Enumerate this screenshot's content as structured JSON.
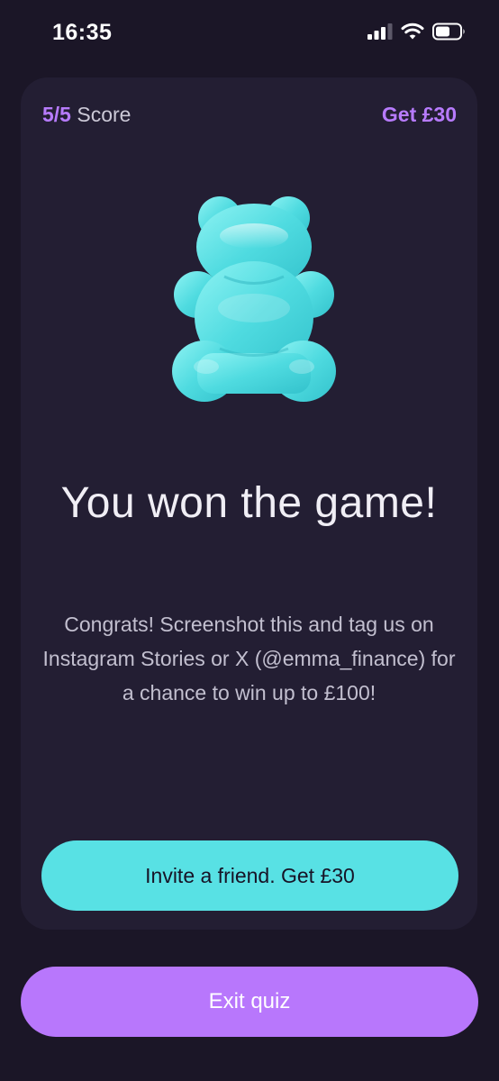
{
  "status_bar": {
    "time": "16:35",
    "icons": [
      "cellular-signal-icon",
      "wifi-icon",
      "battery-icon"
    ]
  },
  "quiz": {
    "score_value": "5/5",
    "score_label": "Score",
    "bonus_link": "Get £30",
    "illustration": "gummy-bear-icon",
    "headline": "You won the game!",
    "message": "Congrats! Screenshot this and tag us on Instagram Stories or X (@emma_finance) for a chance to win up to £100!",
    "invite_button": "Invite a friend. Get £30",
    "exit_button": "Exit quiz"
  },
  "colors": {
    "background": "#1b1627",
    "card": "#231e33",
    "accent_purple": "#b877fc",
    "accent_cyan": "#58e1e4",
    "text_primary": "#f0eef5",
    "text_secondary": "#c2bfcf"
  }
}
